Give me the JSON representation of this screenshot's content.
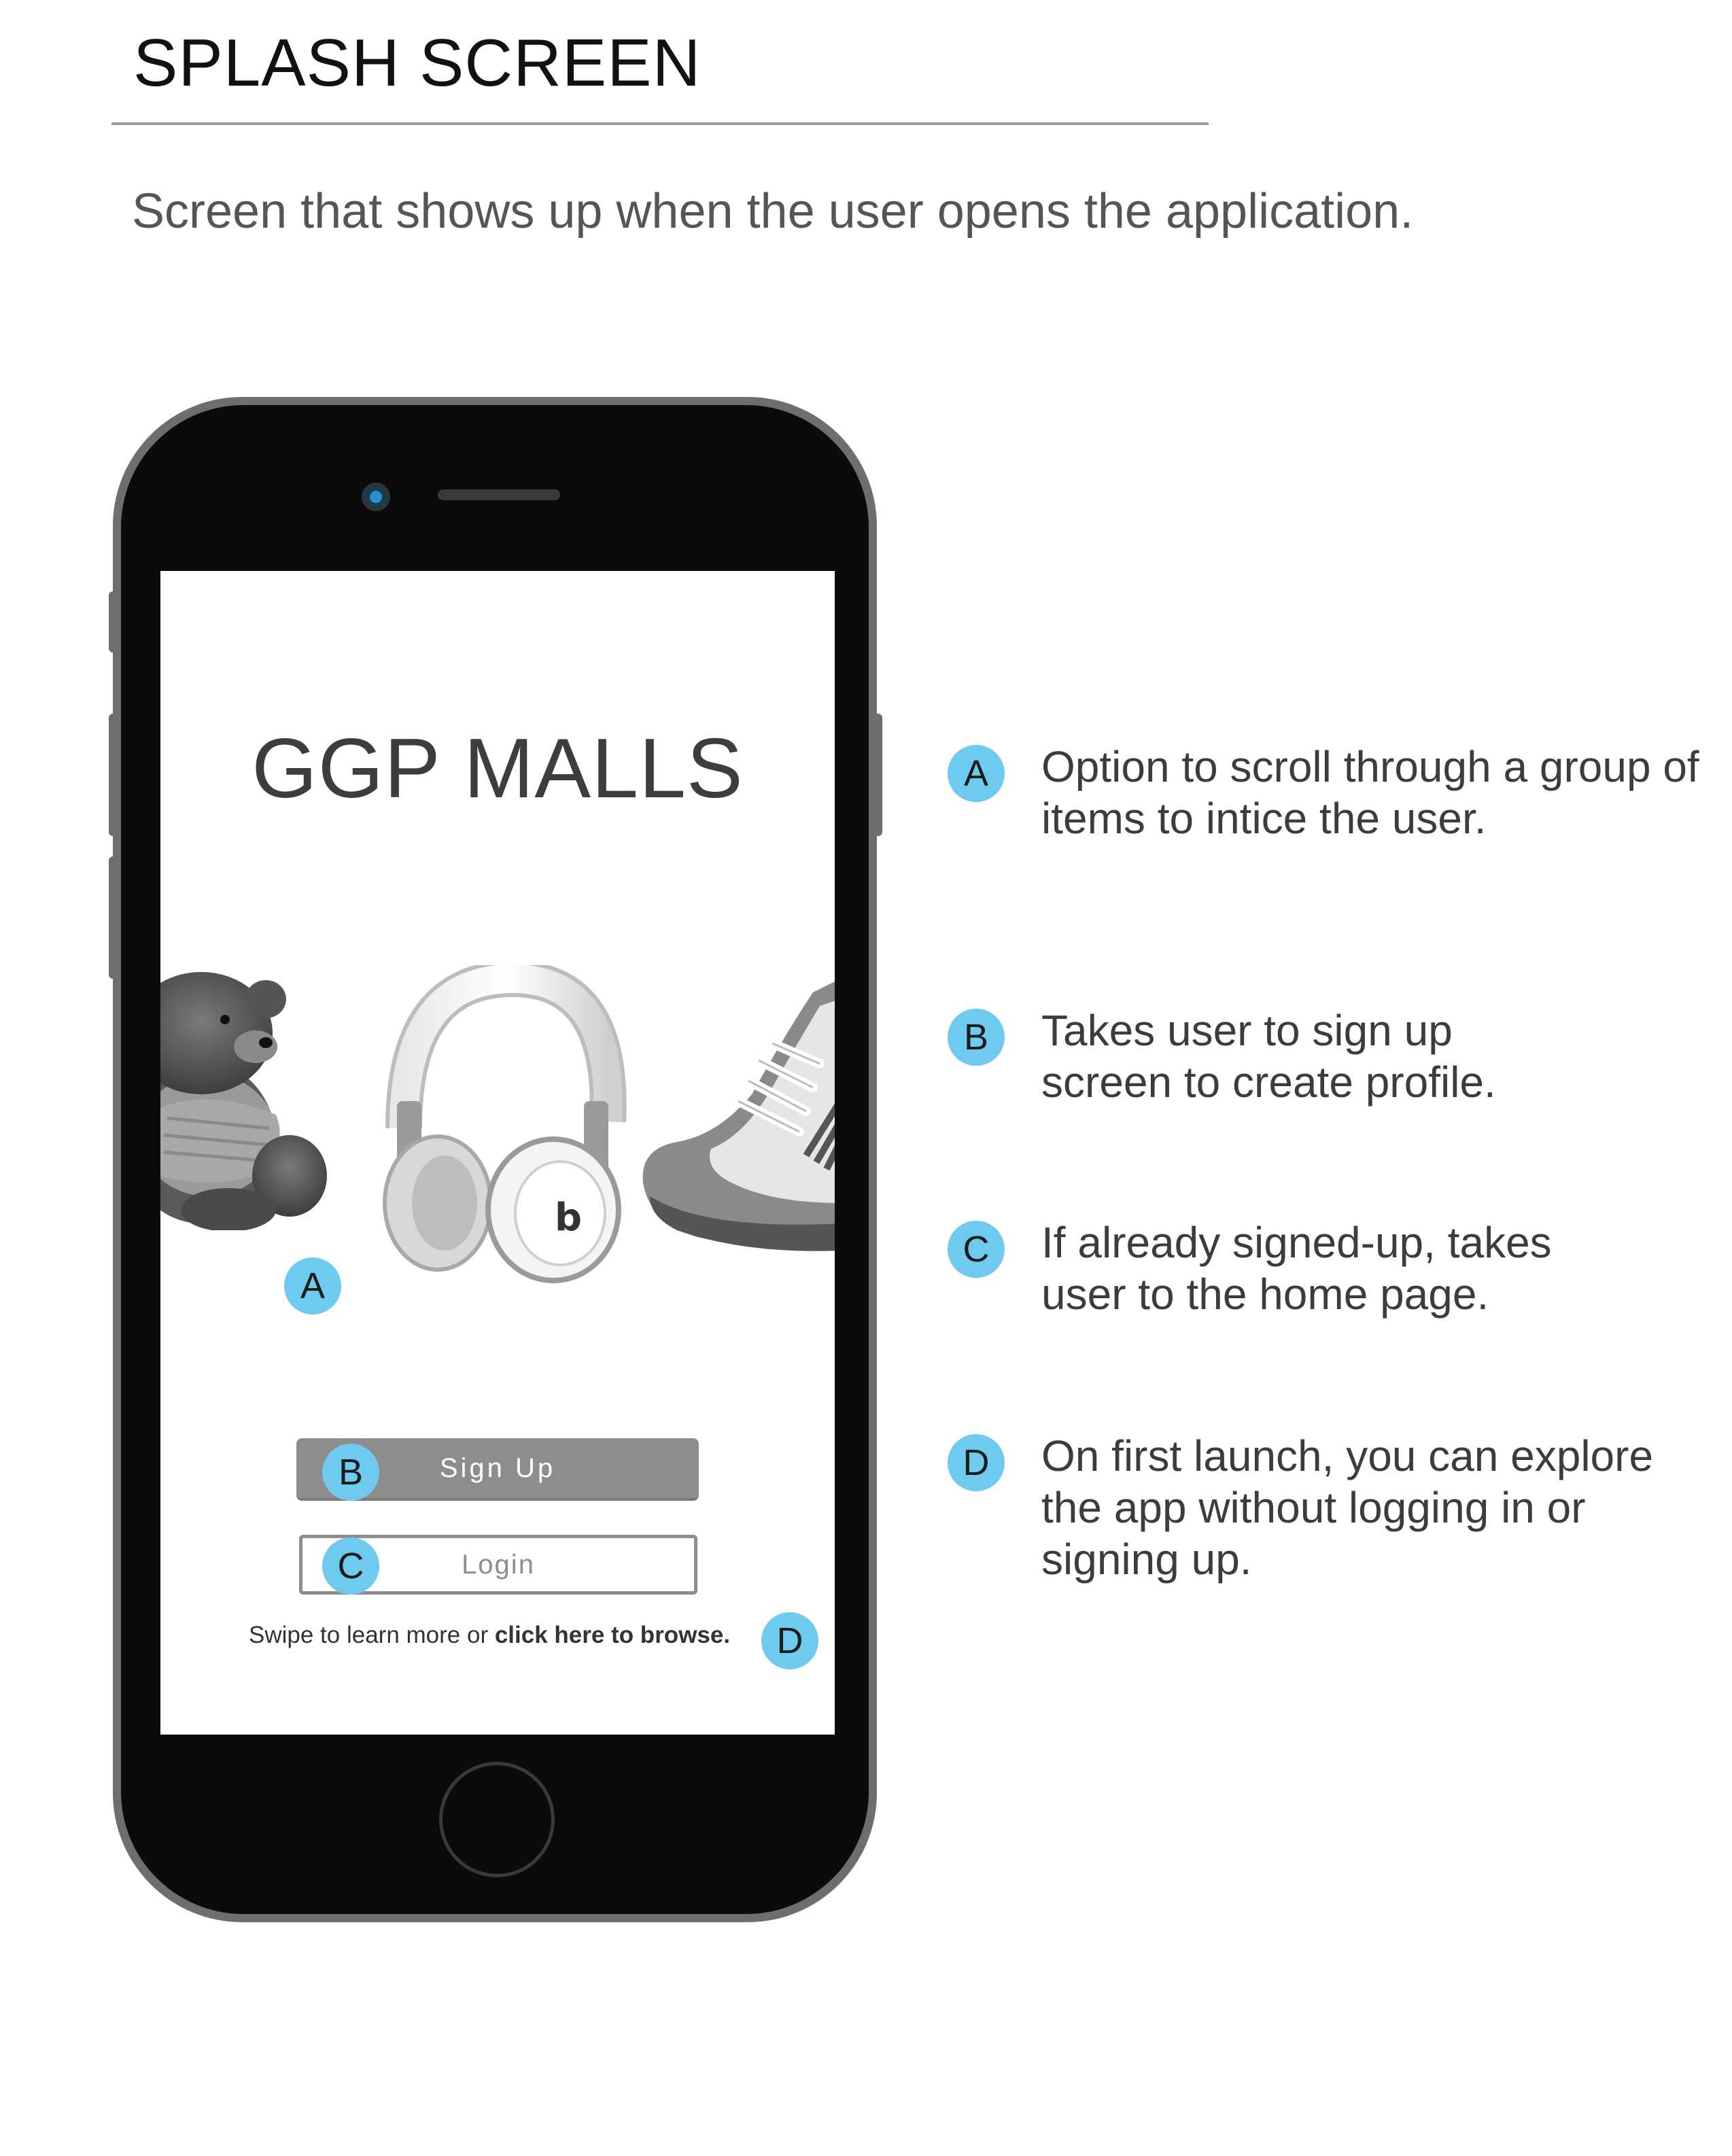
{
  "header": {
    "title": "SPLASH SCREEN",
    "subtitle": "Screen that shows up when the user opens the application."
  },
  "phone_screen": {
    "app_title": "GGP MALLS",
    "products": [
      "teddy-bear",
      "headphones",
      "sneaker"
    ],
    "signup_label": "Sign Up",
    "login_label": "Login",
    "swipe_text": "Swipe to learn more or ",
    "browse_link": "click here to browse."
  },
  "markers": {
    "a": "A",
    "b": "B",
    "c": "C",
    "d": "D"
  },
  "annotations": [
    {
      "marker": "A",
      "text": "Option to scroll through a group of items to intice the user."
    },
    {
      "marker": "B",
      "text": "Takes user to sign up screen to create profile."
    },
    {
      "marker": "C",
      "text": "If already signed-up, takes user to the home page."
    },
    {
      "marker": "D",
      "text": "On first launch, you can explore the app without logging in or signing up."
    }
  ],
  "colors": {
    "marker": "#6fcaf0",
    "signup_button": "#8d8d8d",
    "phone_frame": "#6d6d72"
  }
}
